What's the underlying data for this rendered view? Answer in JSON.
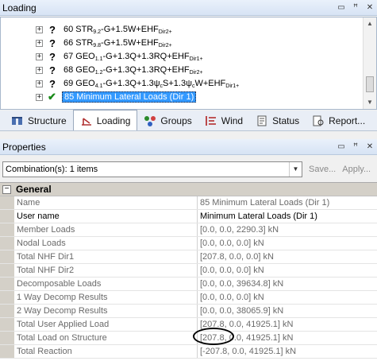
{
  "loading_panel": {
    "title": "Loading",
    "rows": [
      {
        "pre": "60 STR",
        "sub1": "9.2",
        "mid": "-G+1.5W+EHF",
        "sub2": "Dir2+",
        "post": ""
      },
      {
        "pre": "66 STR",
        "sub1": "9.8",
        "mid": "-G+1.5W+EHF",
        "sub2": "Dir2+",
        "post": ""
      },
      {
        "pre": "67 GEO",
        "sub1": "1.1",
        "mid": "-G+1.3Q+1.3RQ+EHF",
        "sub2": "Dir1+",
        "post": ""
      },
      {
        "pre": "68 GEO",
        "sub1": "1.2",
        "mid": "-G+1.3Q+1.3RQ+EHF",
        "sub2": "Dir2+",
        "post": ""
      },
      {
        "pre": "69 GEO",
        "sub1": "4.1",
        "mid": "-G+1.3Q+1.3ψ",
        "sub2": "c",
        "post": "S+1.3ψ",
        "sub3": "c",
        "post2": "W+EHF",
        "sub4": "Dir1+"
      }
    ],
    "selected_row": "85 Minimum Lateral Loads (Dir 1)"
  },
  "tabs": [
    {
      "label": "Structure",
      "icon": "structure-icon"
    },
    {
      "label": "Loading",
      "icon": "loading-icon"
    },
    {
      "label": "Groups",
      "icon": "groups-icon"
    },
    {
      "label": "Wind",
      "icon": "wind-icon"
    },
    {
      "label": "Status",
      "icon": "status-icon"
    },
    {
      "label": "Report...",
      "icon": "report-icon"
    }
  ],
  "properties_panel": {
    "title": "Properties",
    "combo_value": "Combination(s): 1 items",
    "save_label": "Save...",
    "apply_label": "Apply...",
    "category": "General",
    "rows": [
      {
        "name": "Name",
        "value": "85 Minimum Lateral Loads (Dir 1)",
        "editable": false
      },
      {
        "name": "User name",
        "value": "Minimum Lateral Loads (Dir 1)",
        "editable": true
      },
      {
        "name": "Member Loads",
        "value": "[0.0, 0.0, 2290.3] kN",
        "editable": false
      },
      {
        "name": "Nodal Loads",
        "value": "[0.0, 0.0, 0.0] kN",
        "editable": false
      },
      {
        "name": "Total NHF Dir1",
        "value": "[207.8, 0.0, 0.0] kN",
        "editable": false
      },
      {
        "name": "Total NHF Dir2",
        "value": "[0.0, 0.0, 0.0] kN",
        "editable": false
      },
      {
        "name": "Decomposable Loads",
        "value": "[0.0, 0.0, 39634.8] kN",
        "editable": false
      },
      {
        "name": "1 Way Decomp Results",
        "value": "[0.0, 0.0, 0.0] kN",
        "editable": false
      },
      {
        "name": "2 Way Decomp Results",
        "value": "[0.0, 0.0, 38065.9] kN",
        "editable": false
      },
      {
        "name": "Total User Applied Load",
        "value": "[207.8, 0.0, 41925.1] kN",
        "editable": false
      },
      {
        "name": "Total Load on Structure",
        "value": "[207.8, 0.0, 41925.1] kN",
        "editable": false
      },
      {
        "name": "Total Reaction",
        "value": "[-207.8, 0.0, 41925.1] kN",
        "editable": false
      }
    ]
  }
}
